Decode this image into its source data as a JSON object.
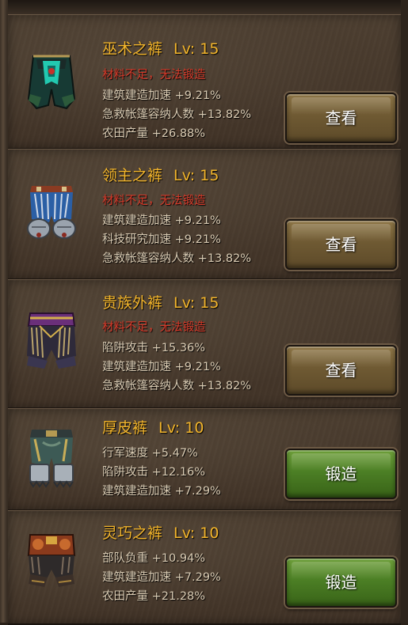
{
  "items": [
    {
      "name": "巫术之裤",
      "level": "Lv: 15",
      "warning": "材料不足，无法锻造",
      "stats": [
        "建筑建造加速 +9.21%",
        "急救帐篷容纳人数 +13.82%",
        "农田产量 +26.88%"
      ],
      "button": "查看",
      "button_type": "view",
      "icon": "sorcery-pants-icon"
    },
    {
      "name": "领主之裤",
      "level": "Lv: 15",
      "warning": "材料不足，无法锻造",
      "stats": [
        "建筑建造加速 +9.21%",
        "科技研究加速 +9.21%",
        "急救帐篷容纳人数 +13.82%"
      ],
      "button": "查看",
      "button_type": "view",
      "icon": "lord-pants-icon"
    },
    {
      "name": "贵族外裤",
      "level": "Lv: 15",
      "warning": "材料不足，无法锻造",
      "stats": [
        "陷阱攻击 +15.36%",
        "建筑建造加速 +9.21%",
        "急救帐篷容纳人数 +13.82%"
      ],
      "button": "查看",
      "button_type": "view",
      "icon": "noble-pants-icon"
    },
    {
      "name": "厚皮裤",
      "level": "Lv: 10",
      "warning": "",
      "stats": [
        "行军速度 +5.47%",
        "陷阱攻击 +12.16%",
        "建筑建造加速 +7.29%"
      ],
      "button": "锻造",
      "button_type": "forge",
      "icon": "thick-leather-pants-icon"
    },
    {
      "name": "灵巧之裤",
      "level": "Lv: 10",
      "warning": "",
      "stats": [
        "部队负重 +10.94%",
        "建筑建造加速 +7.29%",
        "农田产量 +21.28%"
      ],
      "button": "锻造",
      "button_type": "forge",
      "icon": "dexterity-pants-icon"
    }
  ],
  "colors": {
    "title": "#f3b52b",
    "warning": "#d63a2a",
    "stat": "#d9cbb3",
    "view_button": "#6f5a33",
    "forge_button": "#4c7f25"
  }
}
